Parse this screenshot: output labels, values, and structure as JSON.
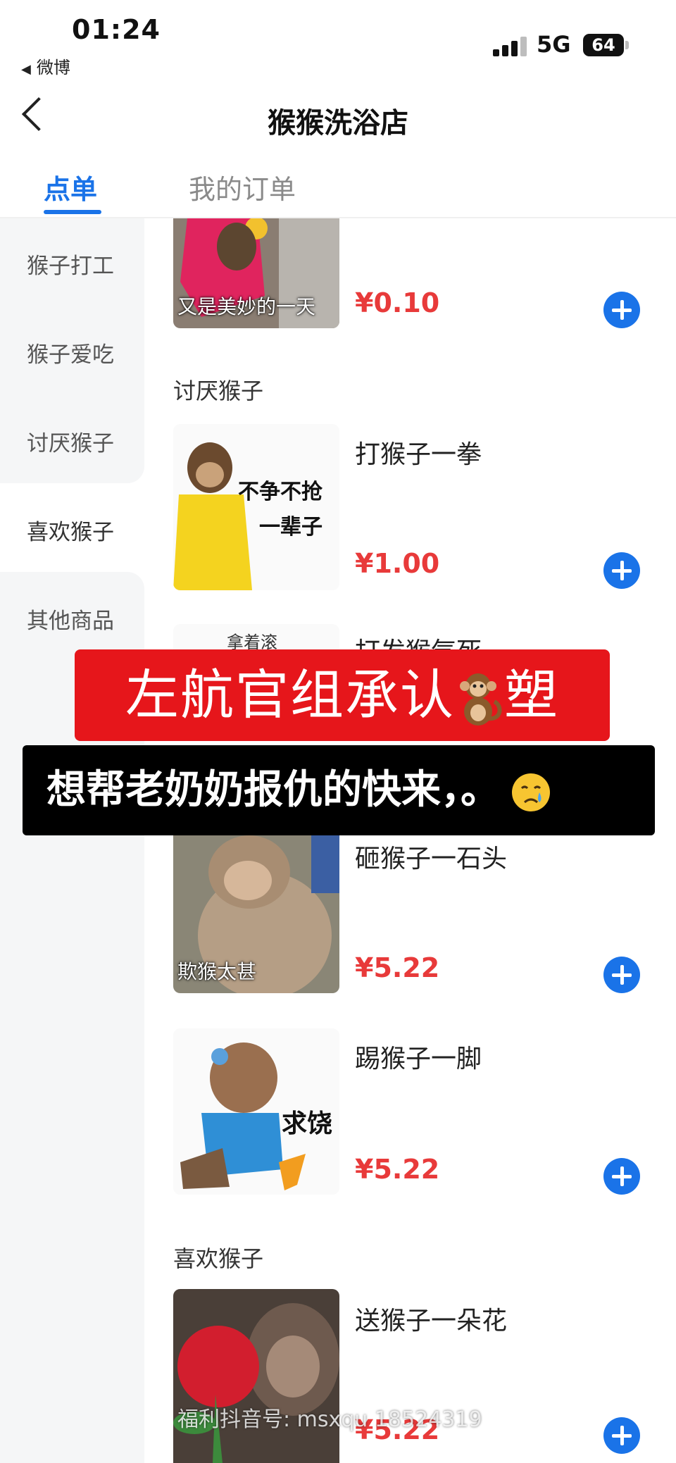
{
  "status_bar": {
    "time": "01:24",
    "back_app": "微博",
    "network": "5G",
    "battery": "64"
  },
  "nav": {
    "title": "猴猴洗浴店"
  },
  "tabs": [
    {
      "label": "点单",
      "active": true
    },
    {
      "label": "我的订单",
      "active": false
    }
  ],
  "sidebar": {
    "items": [
      {
        "label": "猴子打工"
      },
      {
        "label": "猴子爱吃"
      },
      {
        "label": "讨厌猴子"
      },
      {
        "label": "喜欢猴子",
        "selected": true
      },
      {
        "label": "其他商品"
      }
    ]
  },
  "products": [
    {
      "name": "",
      "price": "¥0.10",
      "image_caption": "又是美妙的一天"
    },
    {
      "section": "讨厌猴子"
    },
    {
      "name": "打猴子一拳",
      "price": "¥1.00",
      "image_caption": "不争不抢 一辈子"
    },
    {
      "name": "打发猴气死",
      "price": "",
      "image_caption": "拿着滚"
    },
    {
      "name": "砸猴子一石头",
      "price": "¥5.22",
      "image_caption": "欺猴太甚"
    },
    {
      "name": "踢猴子一脚",
      "price": "¥5.22",
      "image_caption": "求饶"
    },
    {
      "section": "喜欢猴子"
    },
    {
      "name": "送猴子一朵花",
      "price": "¥5.22",
      "image_caption": ""
    }
  ],
  "labels": {
    "section_hate": "讨厌猴子",
    "section_like": "喜欢猴子",
    "p0_caption": "又是美妙的一天",
    "p1_caption_line1": "不争不抢",
    "p1_caption_line2": "一辈子",
    "p2_caption": "拿着滚",
    "p3_caption": "欺猴太甚",
    "p4_caption": "求饶"
  },
  "overlay": {
    "red_caption_before": "左航官组承认",
    "red_caption_after": "塑",
    "black_caption": "想帮老奶奶报仇的快来，。"
  },
  "watermark": "福利抖音号: msxqu 18524319",
  "colors": {
    "accent": "#1a73e8",
    "price": "#e83a3a",
    "banner_red": "#e6161b"
  }
}
